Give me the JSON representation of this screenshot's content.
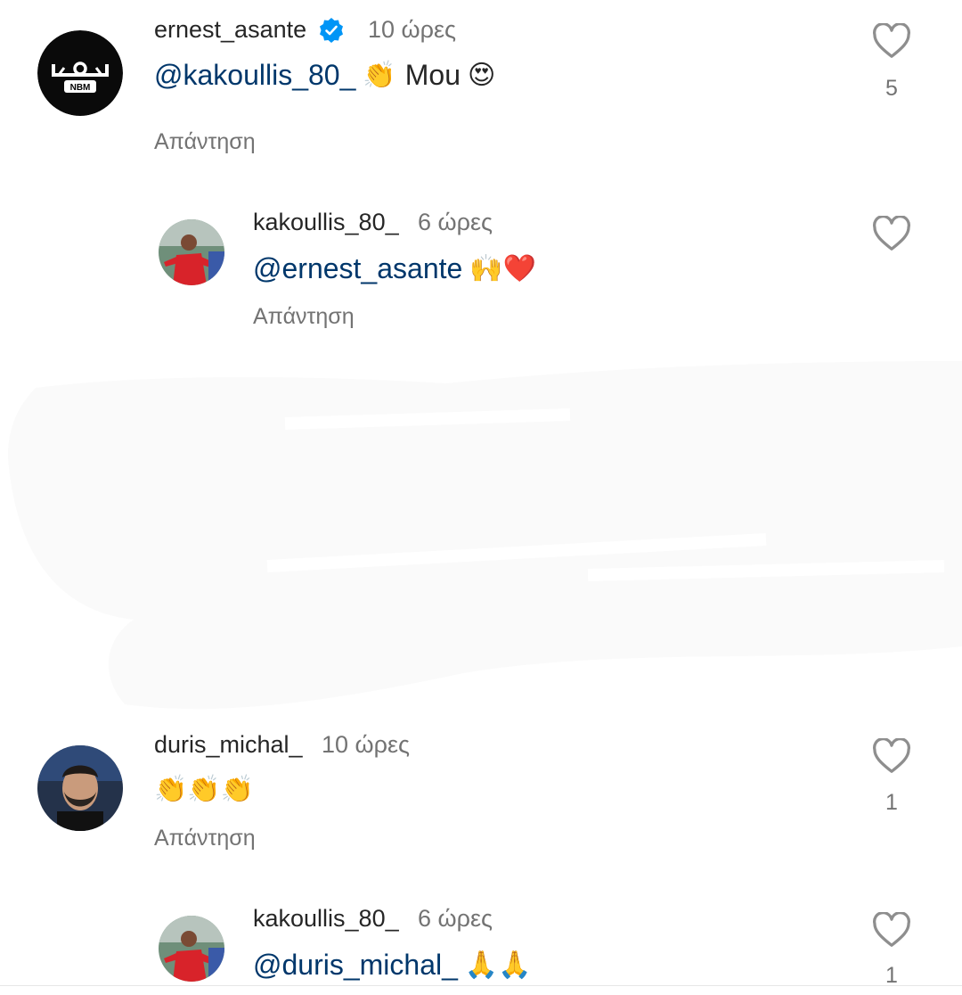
{
  "comments": [
    {
      "username": "ernest_asante",
      "verified": true,
      "time": "10 ώρες",
      "mention": "@kakoullis_80_",
      "emoji_after_mention": "👏",
      "text_after": "Mou",
      "emoji_end": "😍",
      "reply_label": "Απάντηση",
      "likes": "5",
      "avatar_text": "NBM"
    },
    {
      "username": "kakoullis_80_",
      "time": "6 ώρες",
      "mention": "@ernest_asante",
      "emoji_end": "🙌❤️",
      "reply_label": "Απάντηση"
    },
    {
      "username": "duris_michal_",
      "time": "10 ώρες",
      "emoji_text": "👏👏👏",
      "reply_label": "Απάντηση",
      "likes": "1"
    },
    {
      "username": "kakoullis_80_",
      "time": "6 ώρες",
      "mention": "@duris_michal_",
      "emoji_end": "🙏🙏",
      "likes": "1"
    }
  ],
  "colors": {
    "username": "#262626",
    "meta": "#737373",
    "mention": "#00376b",
    "verified": "#0095f6",
    "like_icon": "#8e8e8e"
  },
  "icons": {
    "like": "heart-outline-icon",
    "verified": "verified-badge-icon"
  }
}
